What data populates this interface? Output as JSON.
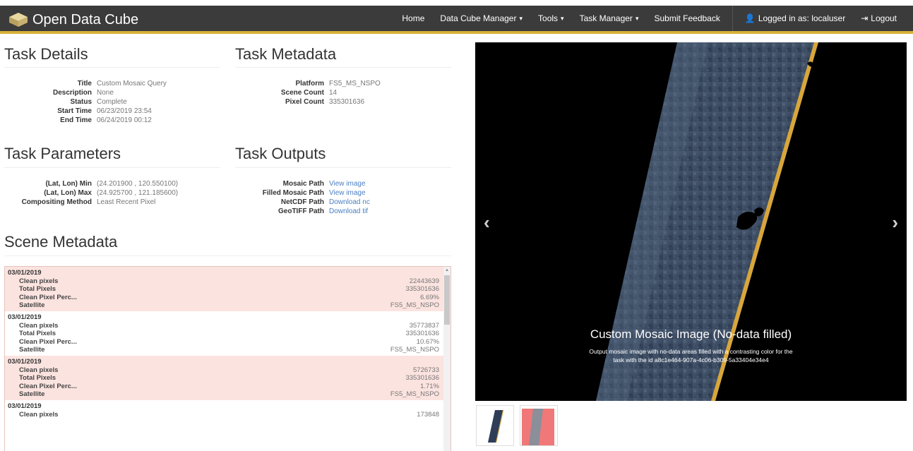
{
  "navbar": {
    "brand": "Open Data Cube",
    "items": [
      {
        "label": "Home",
        "dropdown": false
      },
      {
        "label": "Data Cube Manager",
        "dropdown": true
      },
      {
        "label": "Tools",
        "dropdown": true
      },
      {
        "label": "Task Manager",
        "dropdown": true
      },
      {
        "label": "Submit Feedback",
        "dropdown": false
      }
    ],
    "user": "Logged in as: localuser",
    "logout": "Logout",
    "accent": "#d7b13a"
  },
  "task_details": {
    "heading": "Task Details",
    "rows": [
      {
        "k": "Title",
        "v": "Custom Mosaic Query"
      },
      {
        "k": "Description",
        "v": "None"
      },
      {
        "k": "Status",
        "v": "Complete"
      },
      {
        "k": "Start Time",
        "v": "06/23/2019 23:54"
      },
      {
        "k": "End Time",
        "v": "06/24/2019 00:12"
      }
    ]
  },
  "task_metadata": {
    "heading": "Task Metadata",
    "rows": [
      {
        "k": "Platform",
        "v": "FS5_MS_NSPO"
      },
      {
        "k": "Scene Count",
        "v": "14"
      },
      {
        "k": "Pixel Count",
        "v": "335301636"
      }
    ]
  },
  "task_parameters": {
    "heading": "Task Parameters",
    "rows": [
      {
        "k": "(Lat, Lon) Min",
        "v": "(24.201900 , 120.550100)"
      },
      {
        "k": "(Lat, Lon) Max",
        "v": "(24.925700 , 121.185600)"
      },
      {
        "k": "Compositing Method",
        "v": "Least Recent Pixel"
      }
    ]
  },
  "task_outputs": {
    "heading": "Task Outputs",
    "rows": [
      {
        "k": "Mosaic Path",
        "v": "View image"
      },
      {
        "k": "Filled Mosaic Path",
        "v": "View image"
      },
      {
        "k": "NetCDF Path",
        "v": "Download nc"
      },
      {
        "k": "GeoTIFF Path",
        "v": "Download tif"
      }
    ]
  },
  "scene_metadata": {
    "heading": "Scene Metadata",
    "labels": {
      "clean": "Clean pixels",
      "total": "Total Pixels",
      "percent": "Clean Pixel Perc...",
      "satellite": "Satellite"
    },
    "scenes": [
      {
        "date": "03/01/2019",
        "clean": "22443639",
        "total": "335301636",
        "percent": "6.69%",
        "satellite": "FS5_MS_NSPO"
      },
      {
        "date": "03/01/2019",
        "clean": "35773837",
        "total": "335301636",
        "percent": "10.67%",
        "satellite": "FS5_MS_NSPO"
      },
      {
        "date": "03/01/2019",
        "clean": "5726733",
        "total": "335301636",
        "percent": "1.71%",
        "satellite": "FS5_MS_NSPO"
      },
      {
        "date": "03/01/2019",
        "clean": "173848",
        "total": "",
        "percent": "",
        "satellite": ""
      }
    ]
  },
  "carousel": {
    "prev": "‹",
    "next": "›",
    "caption_title": "Custom Mosaic Image (No-data filled)",
    "caption_text_1": "Output mosaic image with no-data areas filled with a contrasting color for the",
    "caption_text_2": "task with the id a8c1e464-907a-4c06-b309-5a33404e34e4"
  }
}
